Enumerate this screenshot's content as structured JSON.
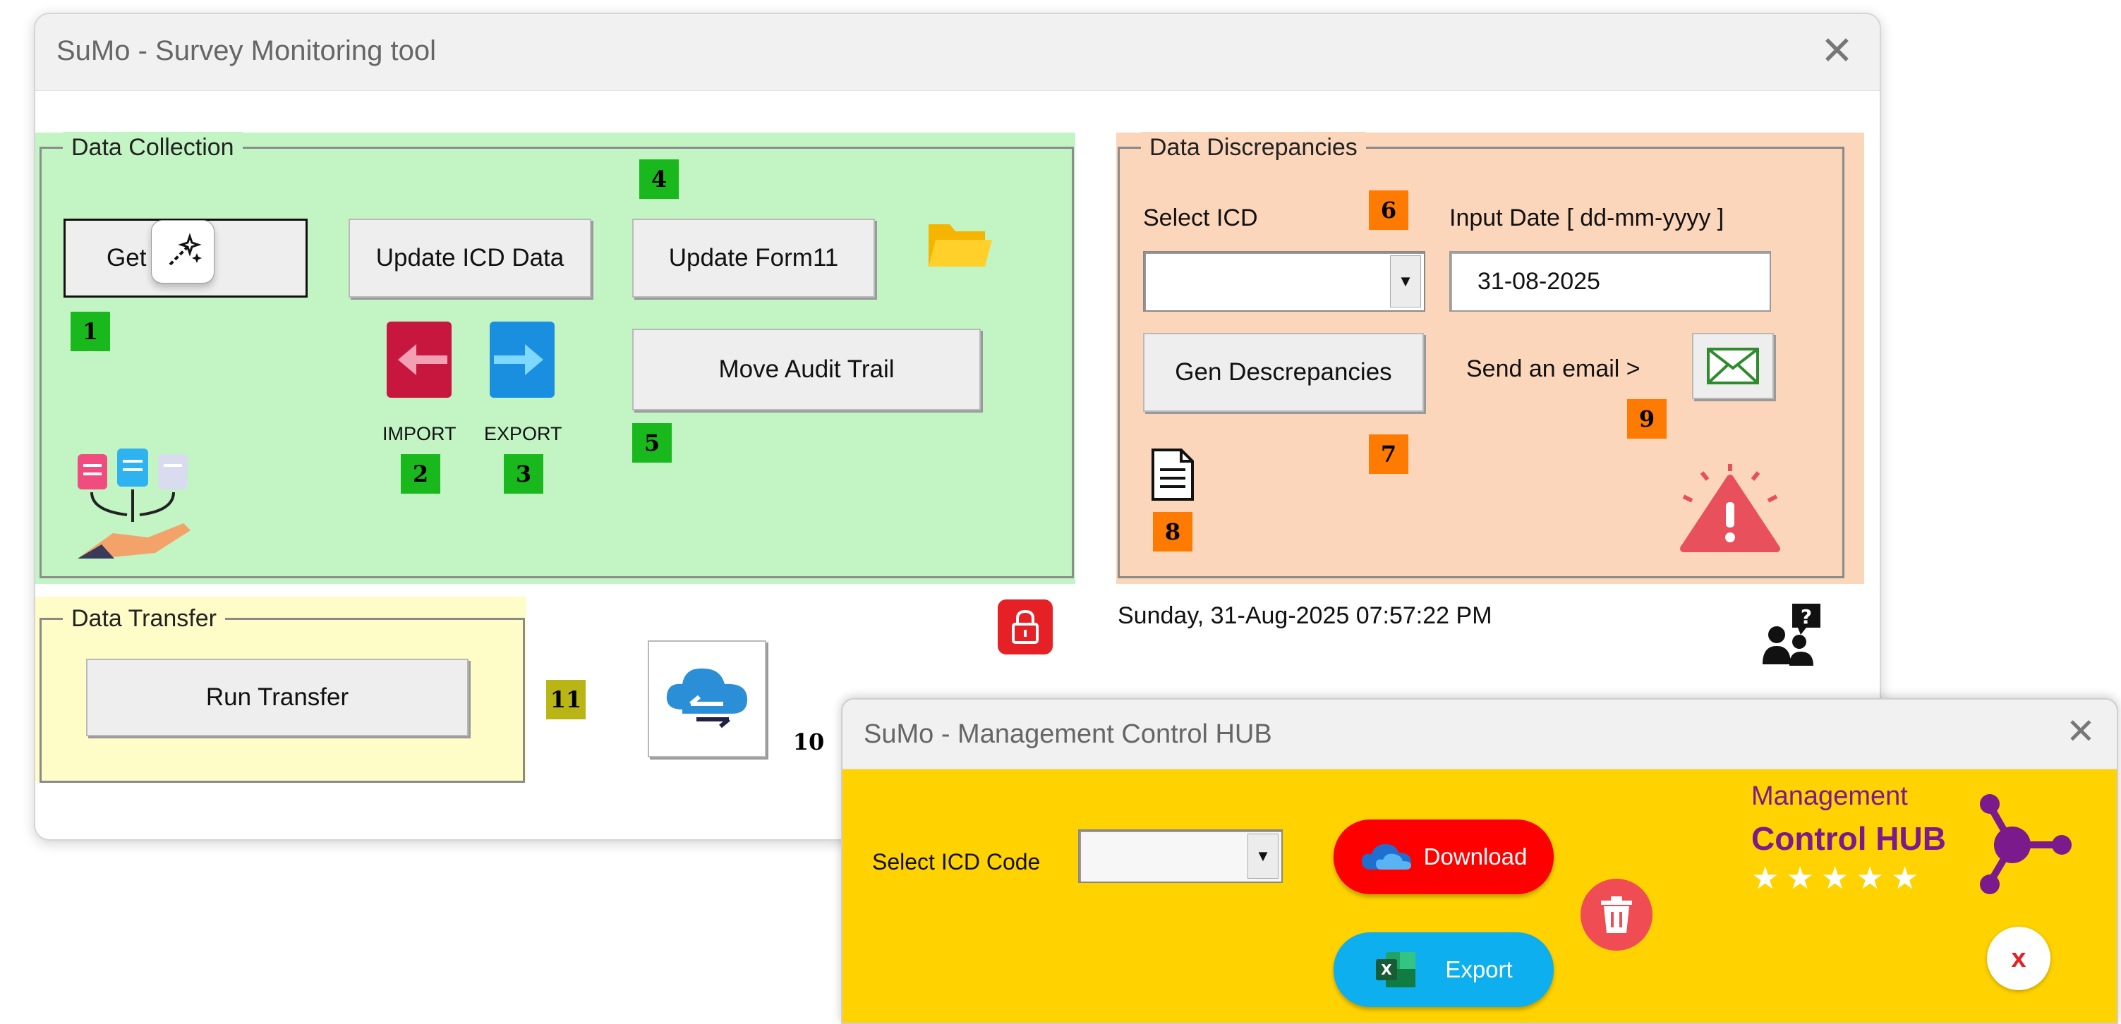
{
  "main_window": {
    "title": "SuMo - Survey Monitoring tool",
    "close": "✕"
  },
  "data_collection": {
    "label": "Data Collection",
    "get_data": "Get Data",
    "update_icd": "Update ICD Data",
    "update_form11": "Update Form11",
    "move_audit": "Move Audit Trail",
    "import": "IMPORT",
    "export": "EXPORT",
    "badges": [
      "1",
      "2",
      "3",
      "4",
      "5"
    ]
  },
  "data_discrepancies": {
    "label": "Data Discrepancies",
    "select_icd": "Select ICD",
    "input_date_label": "Input Date [ dd-mm-yyyy ]",
    "input_date_value": "31-08-2025",
    "gen_button": "Gen Descrepancies",
    "send_email": "Send an email >",
    "badges": [
      "6",
      "7",
      "8",
      "9"
    ]
  },
  "data_transfer": {
    "label": "Data Transfer",
    "run_transfer": "Run Transfer",
    "badges": [
      "10",
      "11"
    ]
  },
  "datetime": "Sunday, 31-Aug-2025 07:57:22 PM",
  "hub_window": {
    "title": "SuMo - Management Control HUB",
    "close": "✕",
    "select_icd_code": "Select ICD Code",
    "download": "Download",
    "export": "Export",
    "brand_line1": "Management",
    "brand_line2": "Control HUB",
    "close_circle": "x",
    "stars": [
      "★",
      "★",
      "★",
      "★",
      "★"
    ]
  },
  "colors": {
    "collection_bg": "#c3f5c4",
    "discrepancy_bg": "#fbd6bb",
    "transfer_bg": "#fefdc8",
    "hub_bg": "#ffd200",
    "brand_purple": "#7a1a8c",
    "download_red": "#ff0000",
    "export_blue": "#0dafee"
  }
}
